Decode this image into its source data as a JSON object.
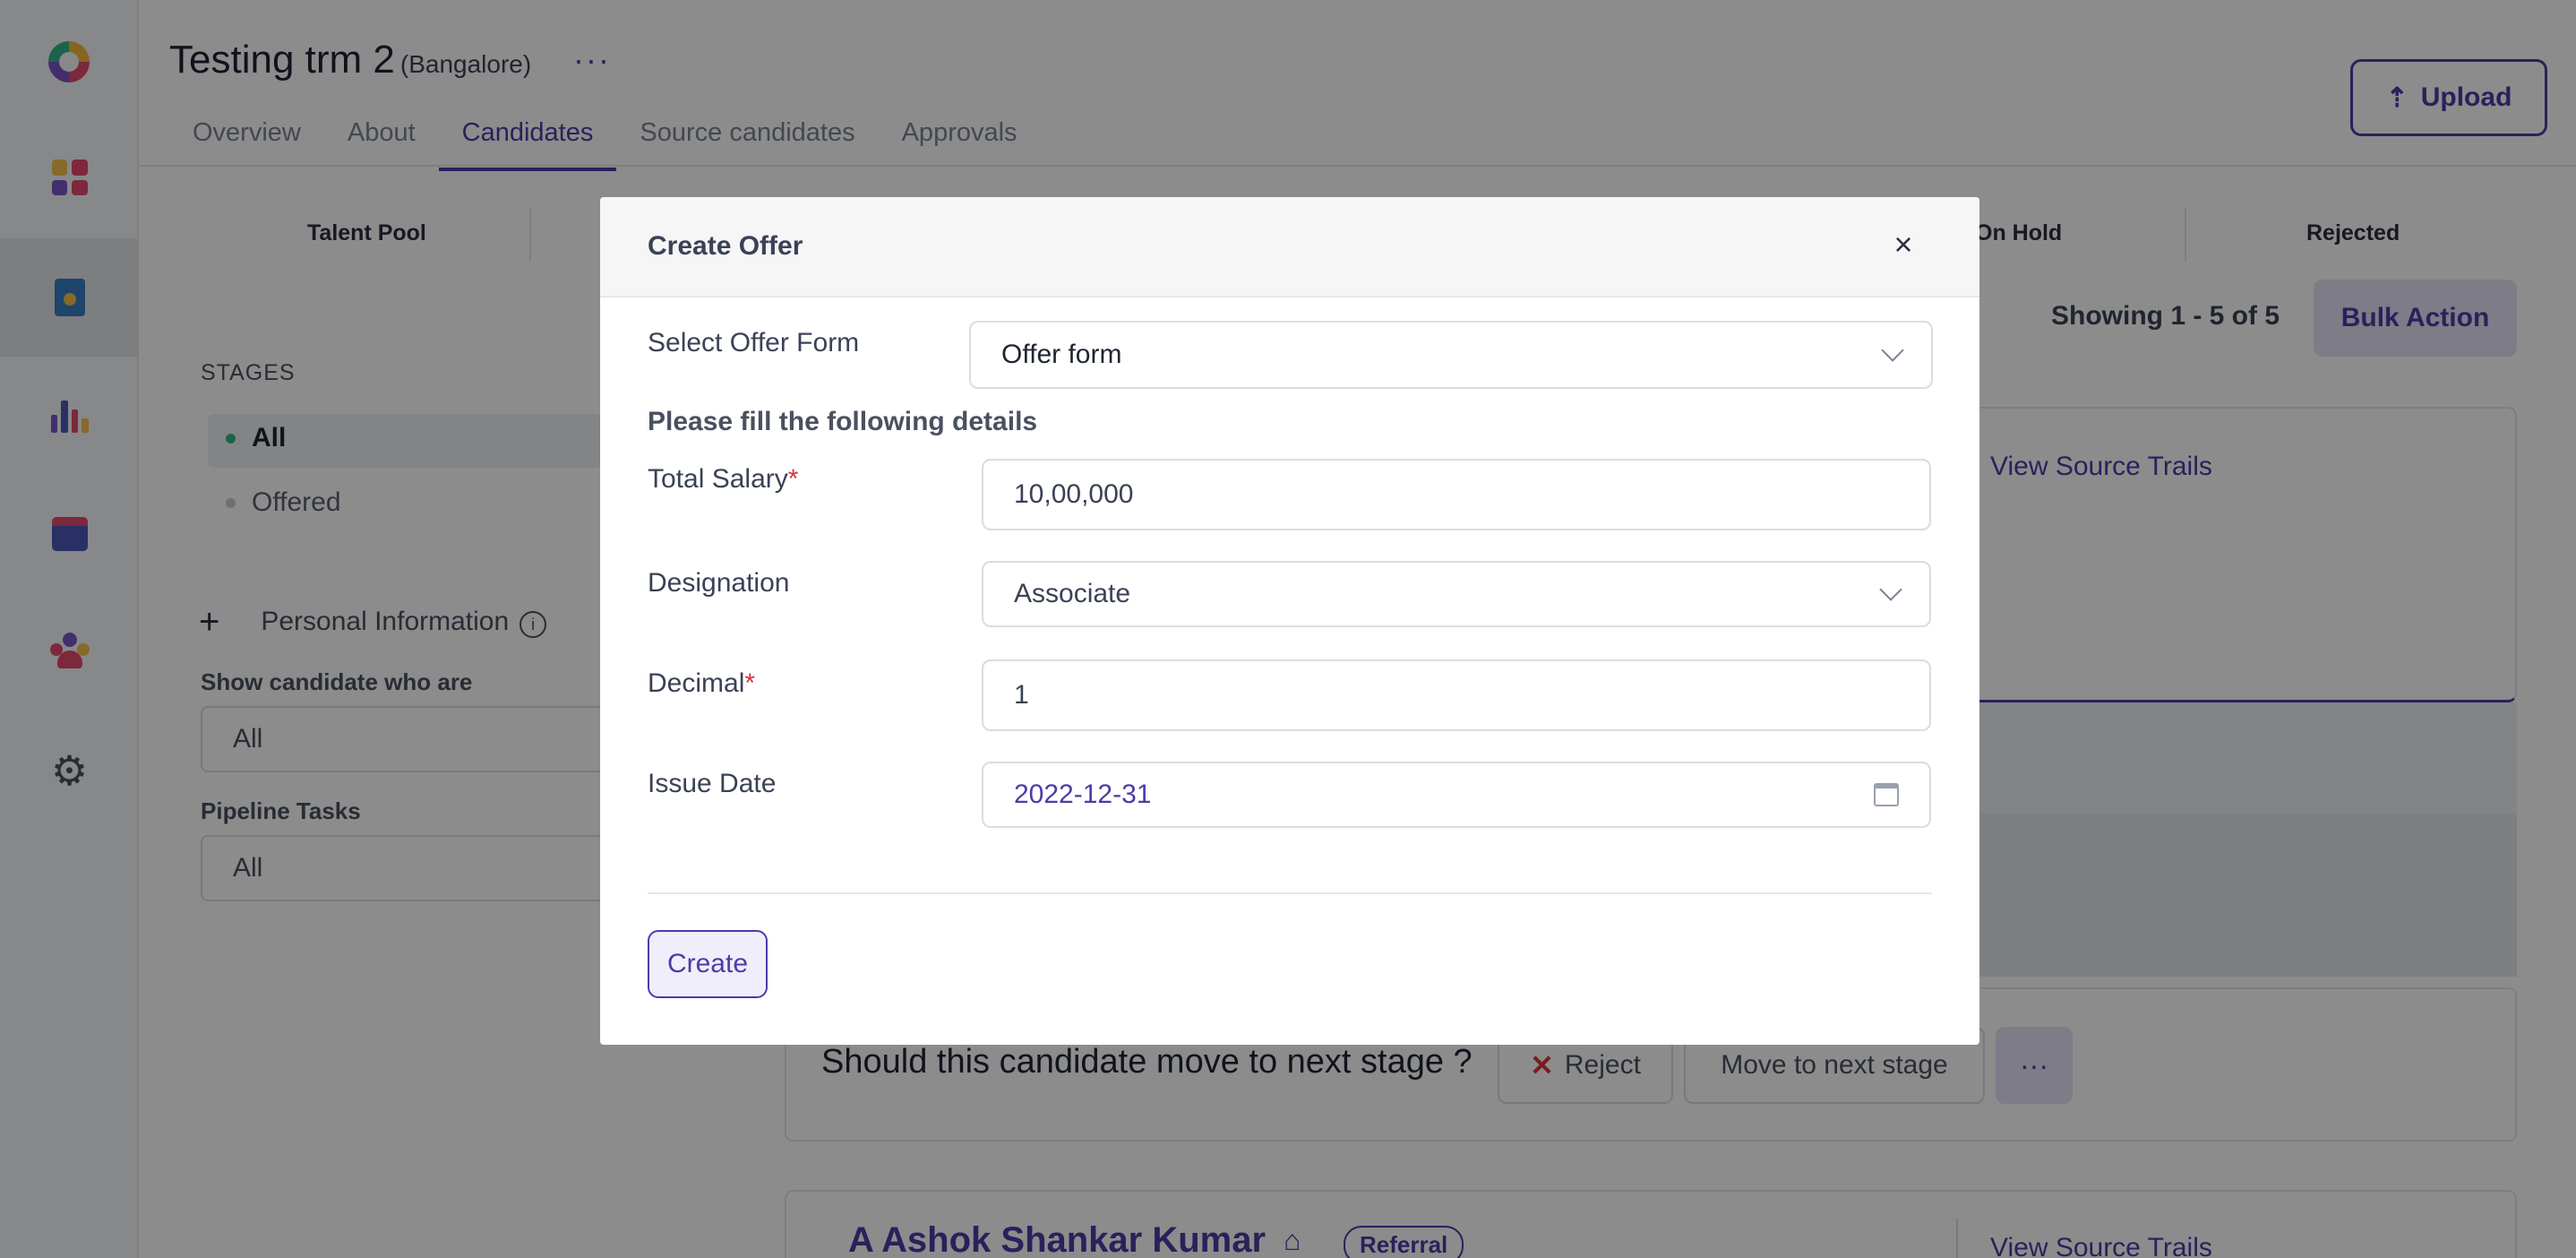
{
  "header": {
    "job_title": "Testing trm 2",
    "job_location": "(Bangalore)",
    "more": "···",
    "upload_label": "Upload",
    "tabs": [
      {
        "label": "Overview"
      },
      {
        "label": "About"
      },
      {
        "label": "Candidates",
        "active": true
      },
      {
        "label": "Source candidates"
      },
      {
        "label": "Approvals"
      }
    ]
  },
  "nav": {
    "icons": [
      "logo-icon",
      "dashboard-icon",
      "jobs-icon",
      "reports-icon",
      "calendar-icon",
      "team-icon",
      "settings-icon"
    ],
    "active": "jobs-icon"
  },
  "stage_strip": {
    "left": "Talent Pool",
    "on_hold": "On Hold",
    "rejected": "Rejected"
  },
  "sidebar": {
    "stages_heading": "STAGES",
    "stages": [
      {
        "label": "All",
        "dot_color": "#34b58a",
        "active": true
      },
      {
        "label": "Offered",
        "dot_color": "#c7cad2"
      }
    ],
    "personal_info_label": "Personal Information",
    "show_label": "Show candidate who are",
    "show_value": "All",
    "tasks_label": "Pipeline Tasks",
    "tasks_value": "All"
  },
  "list": {
    "showing": "Showing 1 - 5 of 5",
    "bulk_action": "Bulk Action",
    "view_source_trails": "View Source Trails",
    "move_question": "Should this candidate move to next stage ?",
    "reject_label": "Reject",
    "next_stage_label": "Move to next stage",
    "more_label": "···",
    "candidate_name": "A Ashok Shankar Kumar",
    "referral_badge": "Referral"
  },
  "modal": {
    "title": "Create Offer",
    "close": "×",
    "select_form_label": "Select Offer Form",
    "select_form_value": "Offer form",
    "section_heading": "Please fill the following details",
    "total_salary_label": "Total Salary",
    "total_salary_value": "10,00,000",
    "designation_label": "Designation",
    "designation_value": "Associate",
    "decimal_label": "Decimal",
    "decimal_value": "1",
    "issue_date_label": "Issue Date",
    "issue_date_value": "2022-12-31",
    "required_mark": "*",
    "create_label": "Create"
  },
  "colors": {
    "accent": "#4b3ca7",
    "required": "#d9353d",
    "overlay": "rgba(0,0,0,0.45)"
  }
}
